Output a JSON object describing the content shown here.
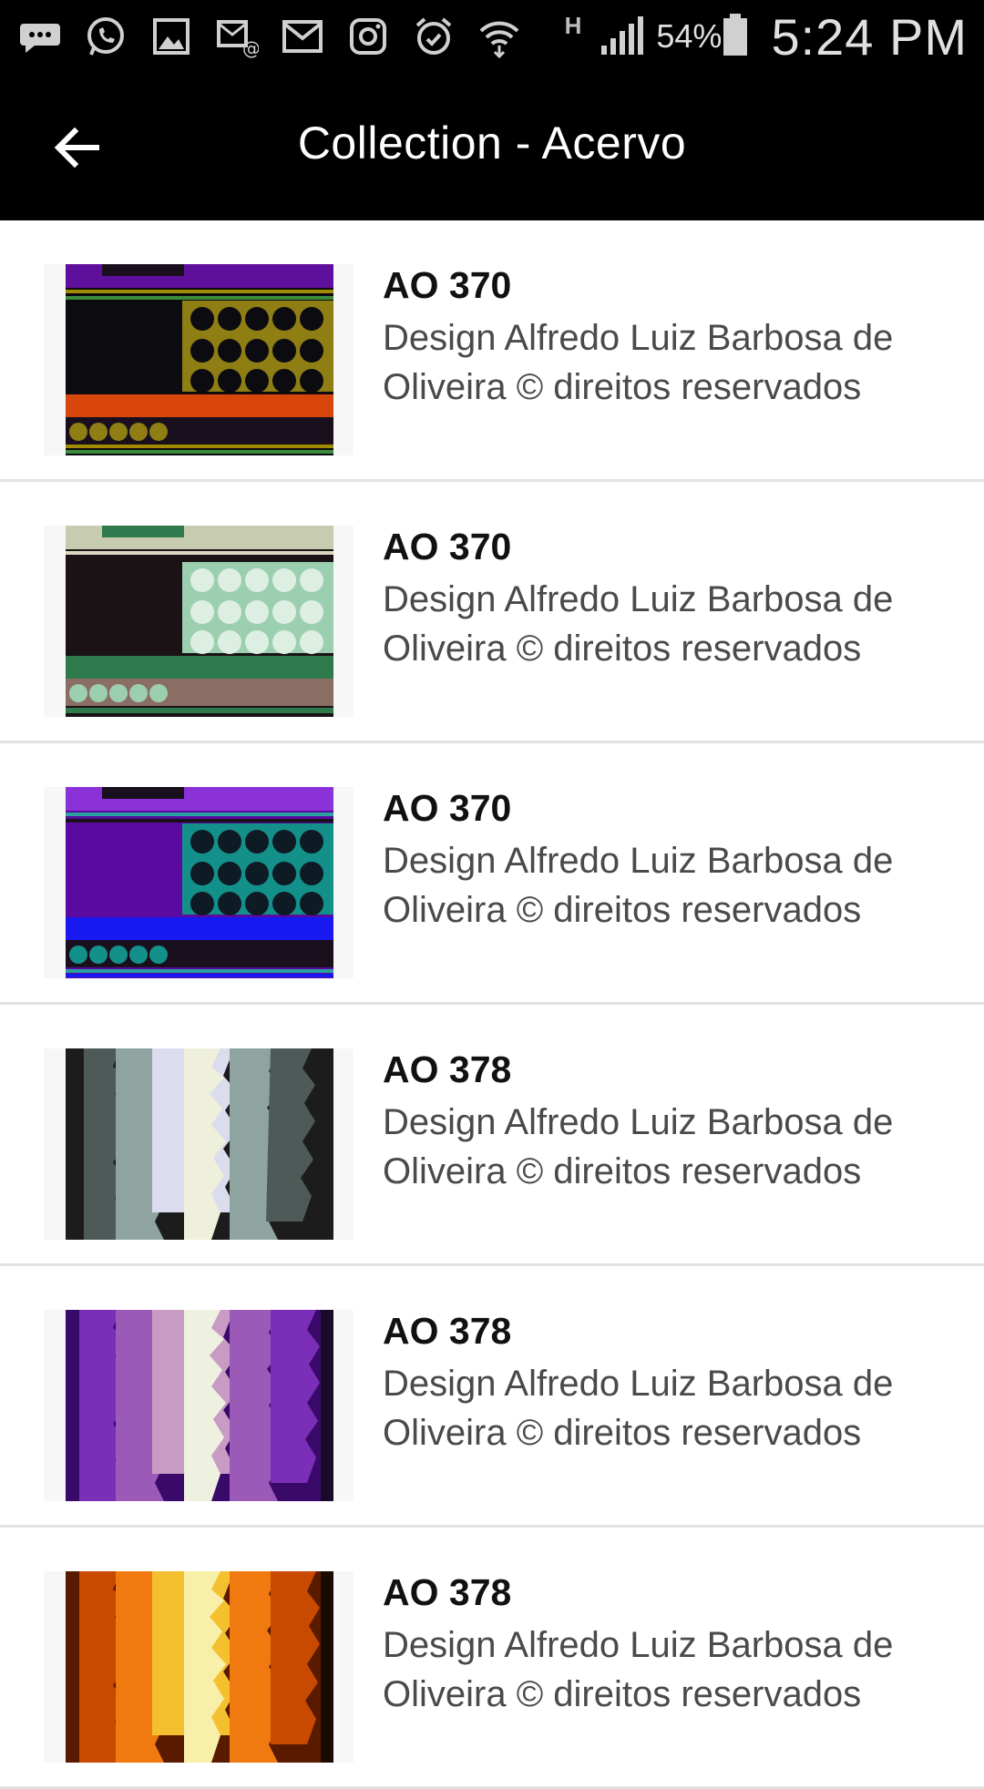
{
  "status_bar": {
    "battery": "54%",
    "time": "5:24 PM",
    "network": "H"
  },
  "header": {
    "title": "Collection - Acervo"
  },
  "items": [
    {
      "code": "AO 370",
      "description": "Design  Alfredo Luiz Barbosa de Oliveira © direitos reservados"
    },
    {
      "code": "AO 370",
      "description": "Design  Alfredo Luiz Barbosa de Oliveira © direitos reservados"
    },
    {
      "code": "AO 370",
      "description": "Design  Alfredo Luiz Barbosa de Oliveira © direitos reservados"
    },
    {
      "code": "AO 378",
      "description": "Design  Alfredo Luiz Barbosa de Oliveira © direitos reservados"
    },
    {
      "code": "AO 378",
      "description": "Design  Alfredo Luiz Barbosa de Oliveira © direitos reservados"
    },
    {
      "code": "AO 378",
      "description": "Design  Alfredo Luiz Barbosa de Oliveira © direitos reservados"
    }
  ]
}
